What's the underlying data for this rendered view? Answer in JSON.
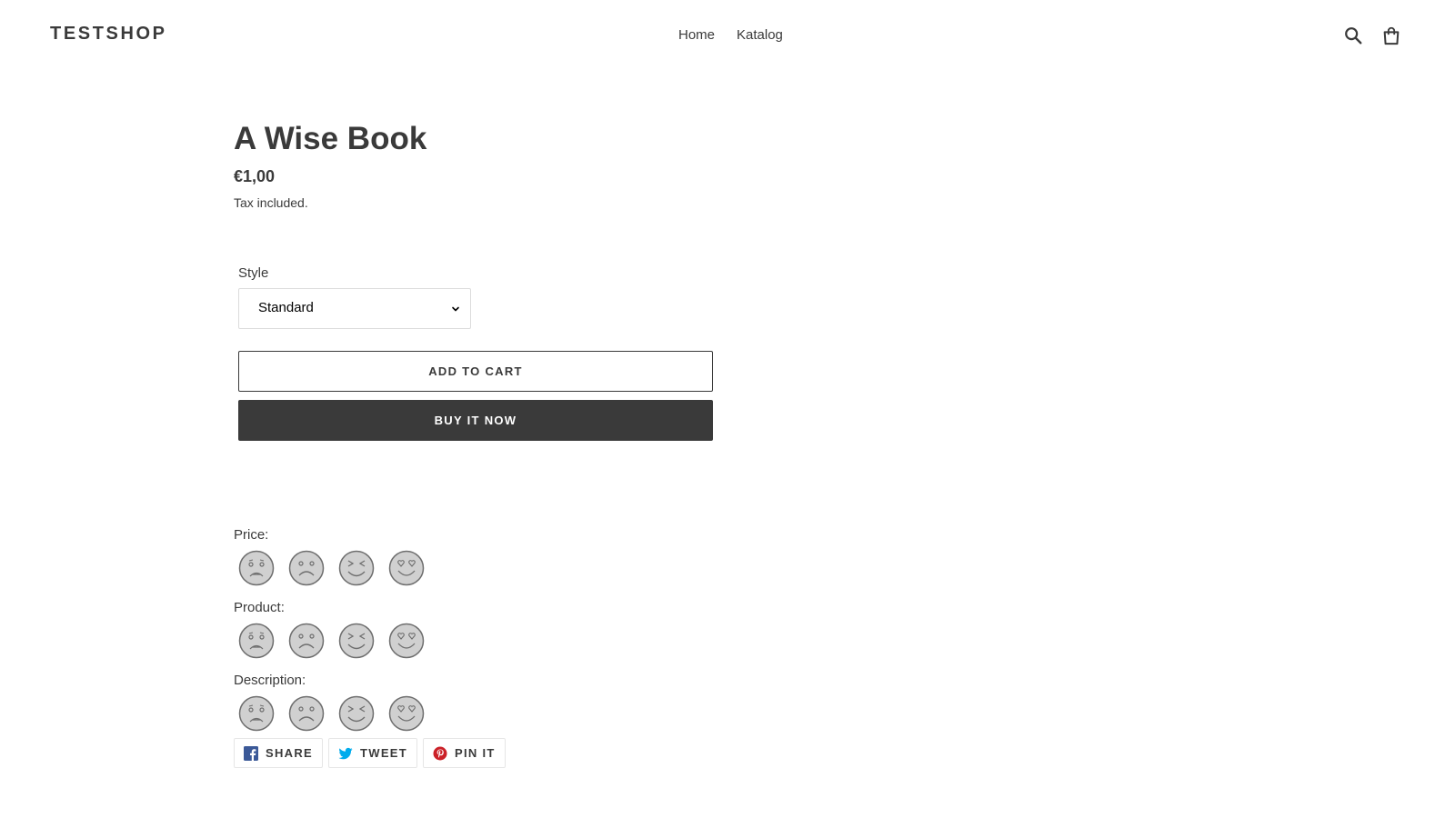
{
  "header": {
    "logo": "TESTSHOP",
    "nav": [
      "Home",
      "Katalog"
    ],
    "icons": [
      "search-icon",
      "cart-icon"
    ]
  },
  "product": {
    "title": "A Wise Book",
    "price": "€1,00",
    "tax_note": "Tax included."
  },
  "variant": {
    "label": "Style",
    "selected": "Standard"
  },
  "buttons": {
    "add_to_cart": "ADD TO CART",
    "buy_now": "BUY IT NOW"
  },
  "ratings": [
    {
      "label": "Price:",
      "faces": [
        "very-sad-face-icon",
        "sad-face-icon",
        "happy-face-icon",
        "love-face-icon"
      ]
    },
    {
      "label": "Product:",
      "faces": [
        "very-sad-face-icon",
        "sad-face-icon",
        "happy-face-icon",
        "love-face-icon"
      ]
    },
    {
      "label": "Description:",
      "faces": [
        "very-sad-face-icon",
        "sad-face-icon",
        "happy-face-icon",
        "love-face-icon"
      ]
    }
  ],
  "share": {
    "facebook": "SHARE",
    "twitter": "TWEET",
    "pinterest": "PIN IT"
  },
  "colors": {
    "text": "#3a3a3a",
    "button_dark": "#3a3a3a",
    "face_fill": "#d0d0d0",
    "face_stroke": "#6e6e6e",
    "facebook": "#3b5998",
    "twitter": "#00aced",
    "pinterest": "#cb2128"
  }
}
